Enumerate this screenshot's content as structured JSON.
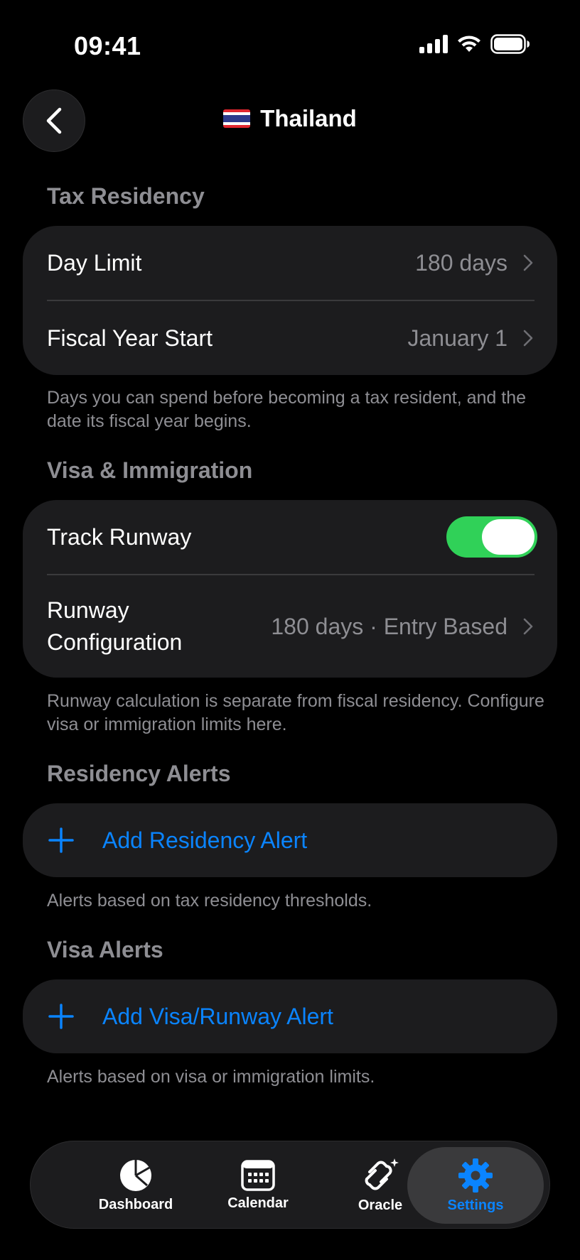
{
  "status_bar": {
    "time": "09:41"
  },
  "nav": {
    "title": "Thailand",
    "flag": "flag-thailand-icon"
  },
  "sections": {
    "tax_residency": {
      "header": "Tax Residency",
      "rows": [
        {
          "label": "Day Limit",
          "value": "180 days"
        },
        {
          "label": "Fiscal Year Start",
          "value": "January 1"
        }
      ],
      "footer": "Days you can spend before becoming a tax resident, and the date its fiscal year begins."
    },
    "visa": {
      "header": "Visa & Immigration",
      "track_runway": {
        "label": "Track Runway",
        "enabled": true
      },
      "runway_config": {
        "label_line1": "Runway",
        "label_line2": "Configuration",
        "value": "180 days · Entry Based"
      },
      "footer": "Runway calculation is separate from fiscal residency. Configure visa or immigration limits here."
    },
    "residency_alerts": {
      "header": "Residency Alerts",
      "add_label": "Add Residency Alert",
      "footer": "Alerts based on tax residency thresholds."
    },
    "visa_alerts": {
      "header": "Visa Alerts",
      "add_label": "Add Visa/Runway Alert",
      "footer": "Alerts based on visa or immigration limits."
    }
  },
  "tab_bar": {
    "tabs": [
      {
        "label": "Dashboard",
        "icon": "pie-chart-icon"
      },
      {
        "label": "Calendar",
        "icon": "calendar-icon"
      },
      {
        "label": "Oracle",
        "icon": "oracle-icon"
      },
      {
        "label": "Settings",
        "icon": "gear-icon",
        "selected": true
      }
    ]
  },
  "colors": {
    "accent": "#0a84ff",
    "toggle_on": "#30d158",
    "card_bg": "#1c1c1e",
    "secondary_text": "#8e8e93"
  }
}
